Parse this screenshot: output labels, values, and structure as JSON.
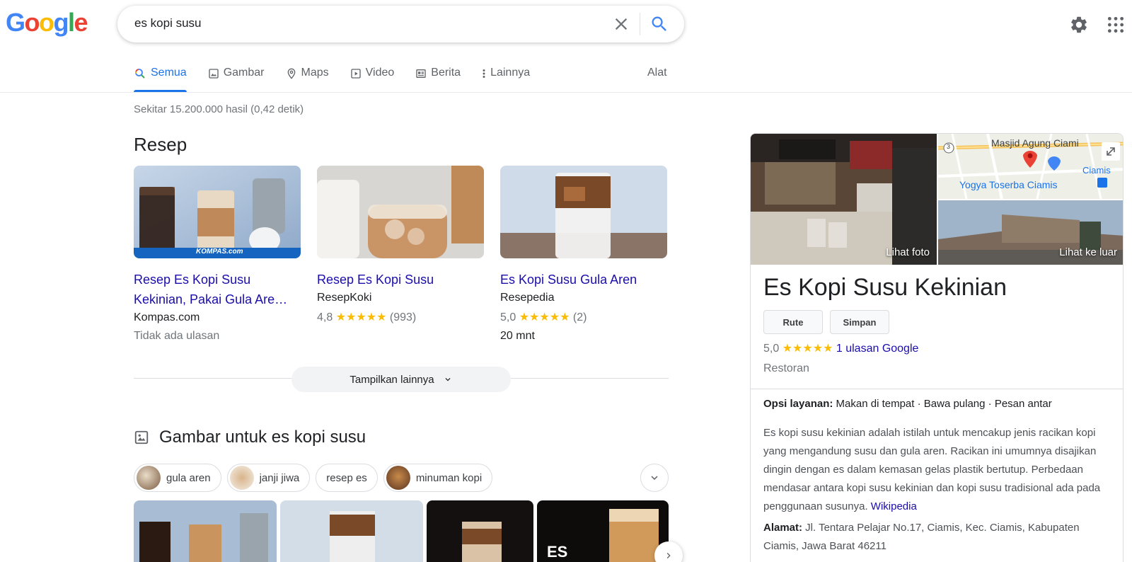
{
  "logo": {
    "letters": [
      "G",
      "o",
      "o",
      "g",
      "l",
      "e"
    ],
    "colors": [
      "#4285f4",
      "#ea4335",
      "#fbbc05",
      "#4285f4",
      "#34a853",
      "#ea4335"
    ]
  },
  "search": {
    "query": "es kopi susu"
  },
  "tabs": [
    {
      "label": "Semua",
      "icon": "search-icon"
    },
    {
      "label": "Gambar",
      "icon": "image-icon"
    },
    {
      "label": "Maps",
      "icon": "map-pin-icon"
    },
    {
      "label": "Video",
      "icon": "video-icon"
    },
    {
      "label": "Berita",
      "icon": "news-icon"
    },
    {
      "label": "Lainnya",
      "icon": "more-vert-icon"
    }
  ],
  "tools_label": "Alat",
  "stats": "Sekitar 15.200.000 hasil (0,42 detik)",
  "recipes": {
    "heading": "Resep",
    "items": [
      {
        "title": "Resep Es Kopi Susu Kekinian, Pakai Gula Are…",
        "source": "Kompas.com",
        "meta": "Tidak ada ulasan",
        "badge": "KOMPAS.com"
      },
      {
        "title": "Resep Es Kopi Susu",
        "source": "ResepKoki",
        "rating": "4,8",
        "stars": "★★★★★",
        "count": "(993)"
      },
      {
        "title": "Es Kopi Susu Gula Aren",
        "source": "Resepedia",
        "rating": "5,0",
        "stars": "★★★★★",
        "count": "(2)",
        "duration": "20 mnt"
      }
    ],
    "more_label": "Tampilkan lainnya"
  },
  "images": {
    "heading": "Gambar untuk es kopi susu",
    "chips": [
      "gula aren",
      "janji jiwa",
      "resep es",
      "minuman kopi"
    ],
    "thumb_text": "ES"
  },
  "knowledge_panel": {
    "photo_label": "Lihat foto",
    "street_label": "Lihat ke luar",
    "map_labels": {
      "mosque": "Masjid Agung Ciami",
      "store": "Yogya Toserba Ciamis",
      "city": "Ciamis",
      "road": "3"
    },
    "title": "Es Kopi Susu Kekinian",
    "buttons": [
      "Rute",
      "Simpan"
    ],
    "rating": "5,0",
    "stars": "★★★★★",
    "reviews_link": "1 ulasan Google",
    "type": "Restoran",
    "service_label": "Opsi layanan:",
    "service_value": " Makan di tempat · Bawa pulang · Pesan antar",
    "description": "Es kopi susu kekinian adalah istilah untuk mencakup jenis racikan kopi yang mengandung susu dan gula aren. Racikan ini umumnya disajikan dingin dengan es dalam kemasan gelas plastik bertutup. Perbedaan mendasar antara kopi susu kekinian dan kopi susu tradisional ada pada penggunaan susunya. ",
    "desc_link": "Wikipedia",
    "address_label": "Alamat:",
    "address_value": " Jl. Tentara Pelajar No.17, Ciamis, Kec. Ciamis, Kabupaten Ciamis, Jawa Barat 46211"
  }
}
